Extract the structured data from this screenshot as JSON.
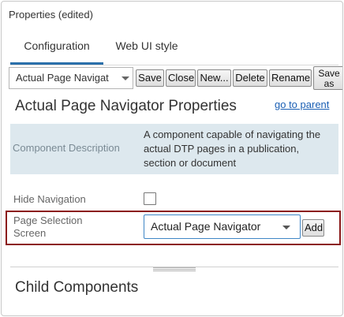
{
  "panel": {
    "title": "Properties (edited)"
  },
  "tabs": [
    {
      "label": "Configuration",
      "active": true
    },
    {
      "label": "Web UI style",
      "active": false
    }
  ],
  "toolbar": {
    "selector_value": "Actual Page Navigat",
    "save_label": "Save",
    "close_label": "Close",
    "new_label": "New...",
    "delete_label": "Delete",
    "rename_label": "Rename",
    "saveas_label": "Save as"
  },
  "properties": {
    "title": "Actual Page Navigator Properties",
    "go_to_parent": "go to parent",
    "description_label": "Component Description",
    "description_text": "A component capable of navigating the actual DTP pages in a publication, section or document",
    "hide_navigation_label": "Hide Navigation",
    "hide_navigation_checked": false,
    "page_selection_label": "Page Selection Screen",
    "page_selection_value": "Actual Page Navigator",
    "add_label": "Add"
  },
  "child_components": {
    "title": "Child Components"
  },
  "colors": {
    "accent": "#2a6faa",
    "link": "#1a5fb4",
    "highlight_border": "#8b1a1a",
    "description_bg": "#dde8ee"
  }
}
